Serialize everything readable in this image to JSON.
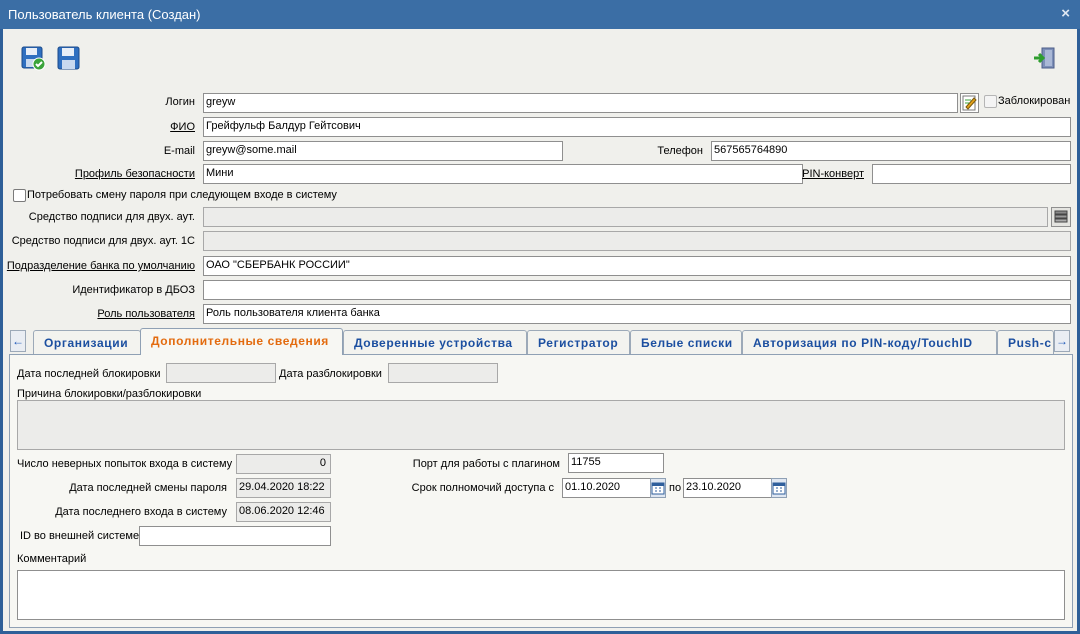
{
  "window": {
    "title": "Пользователь клиента (Создан)",
    "close_glyph": "×"
  },
  "toolbar": {
    "save_close_icon": "save-check-icon",
    "save_icon": "save-icon",
    "exit_icon": "exit-door-icon"
  },
  "form": {
    "login_label": "Логин",
    "login_value": "greyw",
    "blocked_label": "Заблокирован",
    "fio_label": "ФИО",
    "fio_value": "Грейфульф Балдур Гейтсович",
    "email_label": "E-mail",
    "email_value": "greyw@some.mail",
    "phone_label": "Телефон",
    "phone_value": "567565764890",
    "profile_label": "Профиль безопасности",
    "profile_value": "Мини",
    "pin_label": "PIN-конверт",
    "pin_value": "",
    "require_pw_label": "Потребовать смену пароля при следующем входе в систему",
    "sign2fa_label": "Средство подписи для двух. аут.",
    "sign2fa_value": "",
    "sign2fa1c_label": "Средство подписи для двух. аут. 1С",
    "sign2fa1c_value": "",
    "bank_unit_label": "Подразделение банка по умолчанию",
    "bank_unit_value": "ОАО \"СБЕРБАНК РОССИИ\"",
    "dboz_label": "Идентификатор в ДБОЗ",
    "dboz_value": "",
    "role_label": "Роль пользователя",
    "role_value": "Роль пользователя клиента банка"
  },
  "tabs": [
    {
      "label": "Организации"
    },
    {
      "label": "Дополнительные сведения",
      "active": true
    },
    {
      "label": "Доверенные устройства"
    },
    {
      "label": "Регистратор"
    },
    {
      "label": "Белые списки"
    },
    {
      "label": "Авторизация по PIN-коду/TouchID"
    },
    {
      "label": "Push-c"
    }
  ],
  "details": {
    "last_block_label": "Дата последней блокировки",
    "last_block_value": "",
    "unblock_label": "Дата разблокировки",
    "unblock_value": "",
    "reason_label": "Причина блокировки/разблокировки",
    "reason_value": "",
    "failed_label": "Число неверных попыток входа в систему",
    "failed_value": "0",
    "pw_change_label": "Дата последней смены пароля",
    "pw_change_value": "29.04.2020 18:22",
    "last_login_label": "Дата последнего входа в систему",
    "last_login_value": "08.06.2020 12:46",
    "ext_id_label": "ID во внешней системе",
    "ext_id_value": "",
    "port_label": "Порт для работы с плагином",
    "port_value": "11755",
    "access_label": "Срок полномочий доступа с",
    "access_from": "01.10.2020",
    "to_label": "по",
    "access_to": "23.10.2020",
    "comment_label": "Комментарий",
    "comment_value": ""
  },
  "colors": {
    "titlebar": "#3b6ea5",
    "tab_text": "#1c4fa0",
    "tab_active_text": "#e36b0f",
    "background": "#f0f0ec"
  }
}
